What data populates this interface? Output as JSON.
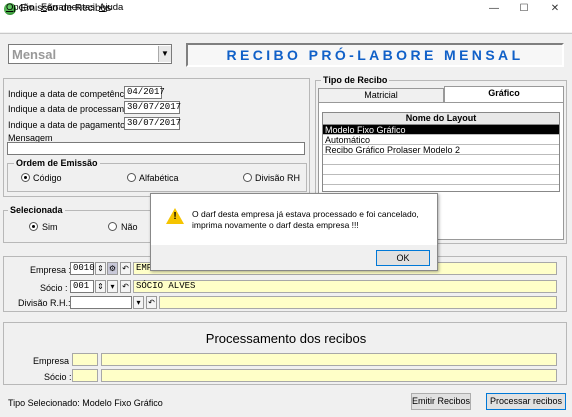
{
  "window": {
    "title": "Emissão de Recibos",
    "minimize": "—",
    "maximize": "☐",
    "close": "✕"
  },
  "menu": [
    {
      "first": "O",
      "rest": "pção"
    },
    {
      "first": "F",
      "rest": "erramentas"
    },
    {
      "first": "A",
      "rest": "juda"
    }
  ],
  "period_combo": {
    "value": "Mensal",
    "arrow": "▼"
  },
  "banner": "RECIBO PRÓ-LABORE MENSAL",
  "dates": {
    "competencia_label": "Indique a data de competência",
    "competencia": "04/2017",
    "processamento_label": "Indique a data de processamento",
    "processamento": "30/07/2017",
    "pagamento_label": "Indique a data de pagamento",
    "pagamento": "30/07/2017",
    "mensagem_label": "Mensagem",
    "mensagem": ""
  },
  "ordem": {
    "title": "Ordem de Emissão",
    "options": [
      "Código",
      "Alfabética",
      "Divisão RH"
    ],
    "selected": 0
  },
  "selecionada": {
    "title": "Selecionada",
    "options": [
      "Sim",
      "Não"
    ],
    "selected": 0
  },
  "tipo_recibo": {
    "title": "Tipo de Recibo",
    "tabs": [
      "Matricial",
      "Gráfico"
    ],
    "active_tab": 1,
    "list_header": "Nome do Layout",
    "items": [
      "Modelo Fixo Gráfico",
      "Automático",
      "Recibo Gráfico Prolaser Modelo 2"
    ]
  },
  "filtros": {
    "empresa_label": "Empresa :",
    "empresa_code": "0010",
    "empresa_name": "EMP",
    "socio_label": "Sócio :",
    "socio_code": "001",
    "socio_name": "SÓCIO ALVES",
    "divisao_label": "Divisão R.H.:",
    "divisao_code": "",
    "divisao_name": ""
  },
  "processamento": {
    "title": "Processamento dos recibos",
    "empresa_label": "Empresa :",
    "socio_label": "Sócio :"
  },
  "dialog": {
    "message": "O darf desta empresa já estava processado e foi cancelado, imprima novamente o darf desta empresa !!!",
    "ok": "OK",
    "warn_mark": "!"
  },
  "status": {
    "tipo": "Tipo Selecionado:  Modelo Fixo Gráfico",
    "emitir": "Emitir Recibos",
    "processar": "Processar recibos"
  }
}
